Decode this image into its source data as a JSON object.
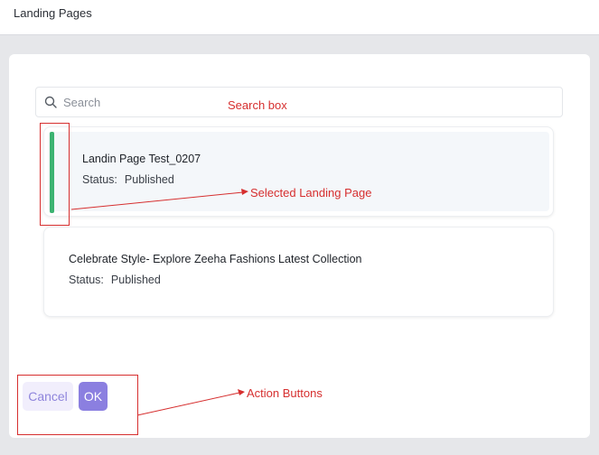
{
  "header": {
    "title": "Landing Pages"
  },
  "search": {
    "placeholder": "Search"
  },
  "landing_pages": [
    {
      "title": "Landin Page Test_0207",
      "status_label": "Status:",
      "status": "Published",
      "selected": true
    },
    {
      "title": "Celebrate Style- Explore Zeeha Fashions Latest Collection",
      "status_label": "Status:",
      "status": "Published",
      "selected": false
    }
  ],
  "actions": {
    "cancel_label": "Cancel",
    "ok_label": "OK"
  },
  "annotations": {
    "search_box": "Search box",
    "selected_page": "Selected Landing Page",
    "action_buttons": "Action Buttons"
  },
  "colors": {
    "accent": "#8b7fe0",
    "selected_bar": "#3cb371",
    "annotation": "#d62f2f"
  }
}
